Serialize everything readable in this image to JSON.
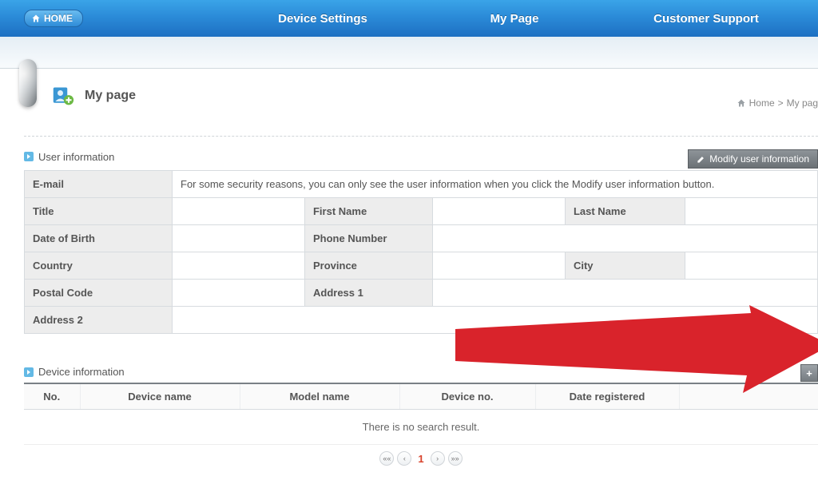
{
  "nav": {
    "home": "HOME",
    "tabs": [
      "Device Settings",
      "My Page",
      "Customer Support"
    ]
  },
  "page": {
    "title": "My page",
    "breadcrumb_home": "Home",
    "breadcrumb_sep": ">",
    "breadcrumb_current": "My pag"
  },
  "user_info": {
    "section": "User information",
    "modify_btn": "Modify user information",
    "notice": "For some security reasons, you can only see the user information when you click the Modify user information button.",
    "labels": {
      "email": "E-mail",
      "title": "Title",
      "first_name": "First Name",
      "last_name": "Last Name",
      "dob": "Date of Birth",
      "phone": "Phone Number",
      "country": "Country",
      "province": "Province",
      "city": "City",
      "postal": "Postal Code",
      "addr1": "Address 1",
      "addr2": "Address 2"
    }
  },
  "device_info": {
    "section": "Device information",
    "columns": {
      "no": "No.",
      "device_name": "Device name",
      "model_name": "Model name",
      "device_no": "Device no.",
      "date_reg": "Date registered",
      "blank": ""
    },
    "empty": "There is no search result.",
    "page_current": "1"
  }
}
